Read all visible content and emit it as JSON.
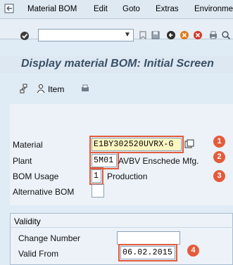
{
  "menubar": {
    "items": [
      {
        "label": "Material BOM"
      },
      {
        "label": "Edit"
      },
      {
        "label": "Goto"
      },
      {
        "label": "Extras"
      },
      {
        "label": "Environme"
      }
    ]
  },
  "toolbar": {
    "command_field": ""
  },
  "page": {
    "title": "Display material BOM: Initial Screen"
  },
  "app_toolbar": {
    "item_label": "Item"
  },
  "form": {
    "material": {
      "label": "Material",
      "value": "E1BY302520UVRX-G"
    },
    "plant": {
      "label": "Plant",
      "value": "5M01",
      "description": "AVBV Enschede Mfg."
    },
    "bom_usage": {
      "label": "BOM Usage",
      "value": "1",
      "description": "Production"
    },
    "alternative_bom": {
      "label": "Alternative BOM",
      "value": ""
    }
  },
  "validity": {
    "title": "Validity",
    "change_number": {
      "label": "Change Number"
    },
    "valid_from": {
      "label": "Valid From",
      "value": "06.02.2015"
    }
  },
  "callouts": [
    "1",
    "2",
    "3",
    "4"
  ],
  "colors": {
    "callout": "#e35b3b",
    "background": "#dfebf5",
    "title_text": "#3b5066"
  },
  "icons": {
    "exit": "exit-icon",
    "enter": "checkmark-icon",
    "save": "save-icon",
    "back": "back-icon",
    "exit2": "exit-session-icon",
    "cancel": "cancel-icon",
    "bom_header": "bom-hierarchy-icon",
    "item": "person-item-icon",
    "print": "print-icon",
    "matchcode": "matchcode-icon"
  }
}
